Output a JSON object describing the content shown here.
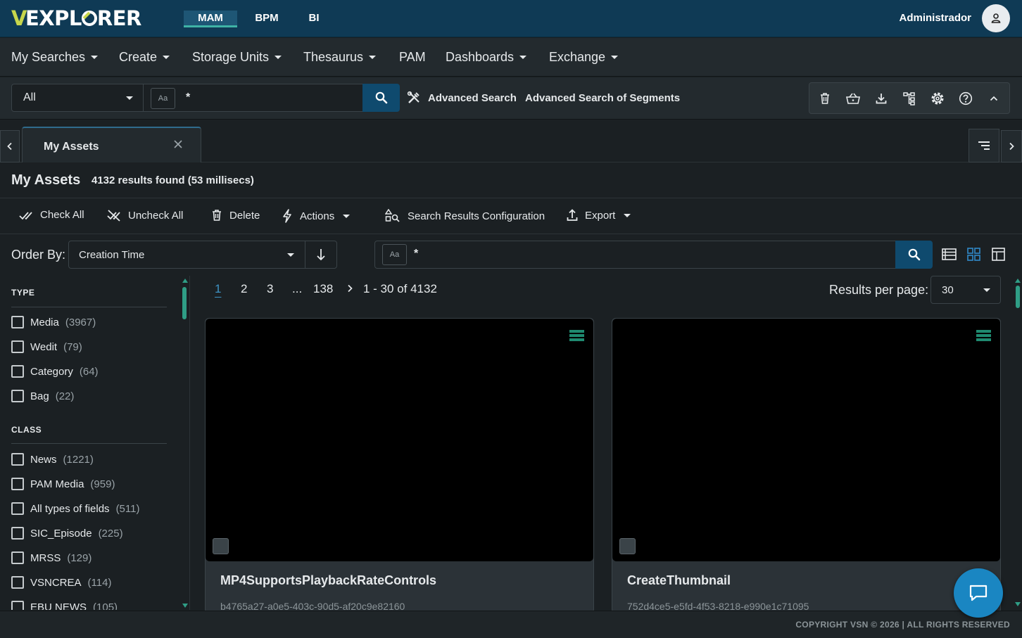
{
  "app": {
    "logo_text": "VEXPLORER",
    "apps": [
      {
        "label": "MAM",
        "active": true
      },
      {
        "label": "BPM",
        "active": false
      },
      {
        "label": "BI",
        "active": false
      }
    ],
    "user_name": "Administrador",
    "user_icon": "person-icon"
  },
  "nav": {
    "items": [
      {
        "label": "My Searches",
        "dropdown": true
      },
      {
        "label": "Create",
        "dropdown": true
      },
      {
        "label": "Storage Units",
        "dropdown": true
      },
      {
        "label": "Thesaurus",
        "dropdown": true
      },
      {
        "label": "PAM",
        "dropdown": false
      },
      {
        "label": "Dashboards",
        "dropdown": true
      },
      {
        "label": "Exchange",
        "dropdown": true
      }
    ]
  },
  "search": {
    "scope_value": "All",
    "case_badge": "Aa",
    "query": "*",
    "advanced_label": "Advanced Search",
    "segments_label": "Advanced Search of Segments",
    "tools": [
      "trash-icon",
      "basket-icon",
      "download-icon",
      "hierarchy-icon",
      "settings-icon",
      "help-icon",
      "chevron-up-icon"
    ]
  },
  "tabs": [
    {
      "label": "My Assets",
      "closable": true,
      "active": true
    }
  ],
  "results": {
    "title": "My Assets",
    "summary": "4132 results found (53 millisecs)"
  },
  "actions": {
    "check_all": "Check All",
    "uncheck_all": "Uncheck All",
    "delete": "Delete",
    "actions": "Actions",
    "config": "Search Results Configuration",
    "export": "Export"
  },
  "order": {
    "label": "Order By:",
    "value": "Creation Time",
    "direction": "descending"
  },
  "filter": {
    "case_badge": "Aa",
    "query": "*"
  },
  "facets": [
    {
      "title": "TYPE",
      "items": [
        {
          "label": "Media",
          "count": "(3967)"
        },
        {
          "label": "Wedit",
          "count": "(79)"
        },
        {
          "label": "Category",
          "count": "(64)"
        },
        {
          "label": "Bag",
          "count": "(22)"
        }
      ]
    },
    {
      "title": "CLASS",
      "items": [
        {
          "label": "News",
          "count": "(1221)"
        },
        {
          "label": "PAM Media",
          "count": "(959)"
        },
        {
          "label": "All types of fields",
          "count": "(511)"
        },
        {
          "label": "SIC_Episode",
          "count": "(225)"
        },
        {
          "label": "MRSS",
          "count": "(129)"
        },
        {
          "label": "VSNCREA",
          "count": "(114)"
        },
        {
          "label": "EBU NEWS",
          "count": "(105)"
        }
      ]
    }
  ],
  "pagination": {
    "pages": [
      "1",
      "2",
      "3",
      "...",
      "138"
    ],
    "current": "1",
    "range": "1 - 30 of 4132",
    "rpp_label": "Results per page:",
    "rpp_value": "30"
  },
  "cards": [
    {
      "title": "MP4SupportsPlaybackRateControls",
      "id": "b4765a27-a0e5-403c-90d5-af20c9e82160"
    },
    {
      "title": "CreateThumbnail",
      "id": "752d4ce5-e5fd-4f53-8218-e990e1c71095"
    }
  ],
  "footer": {
    "text": "COPYRIGHT VSN © 2026 | ALL RIGHTS RESERVED"
  },
  "colors": {
    "topbar": "#0f3a55",
    "accent": "#3fb3a6",
    "search_button": "#0f4a6e",
    "chat_button": "#1a86c2",
    "link_active": "#3e93c4"
  }
}
